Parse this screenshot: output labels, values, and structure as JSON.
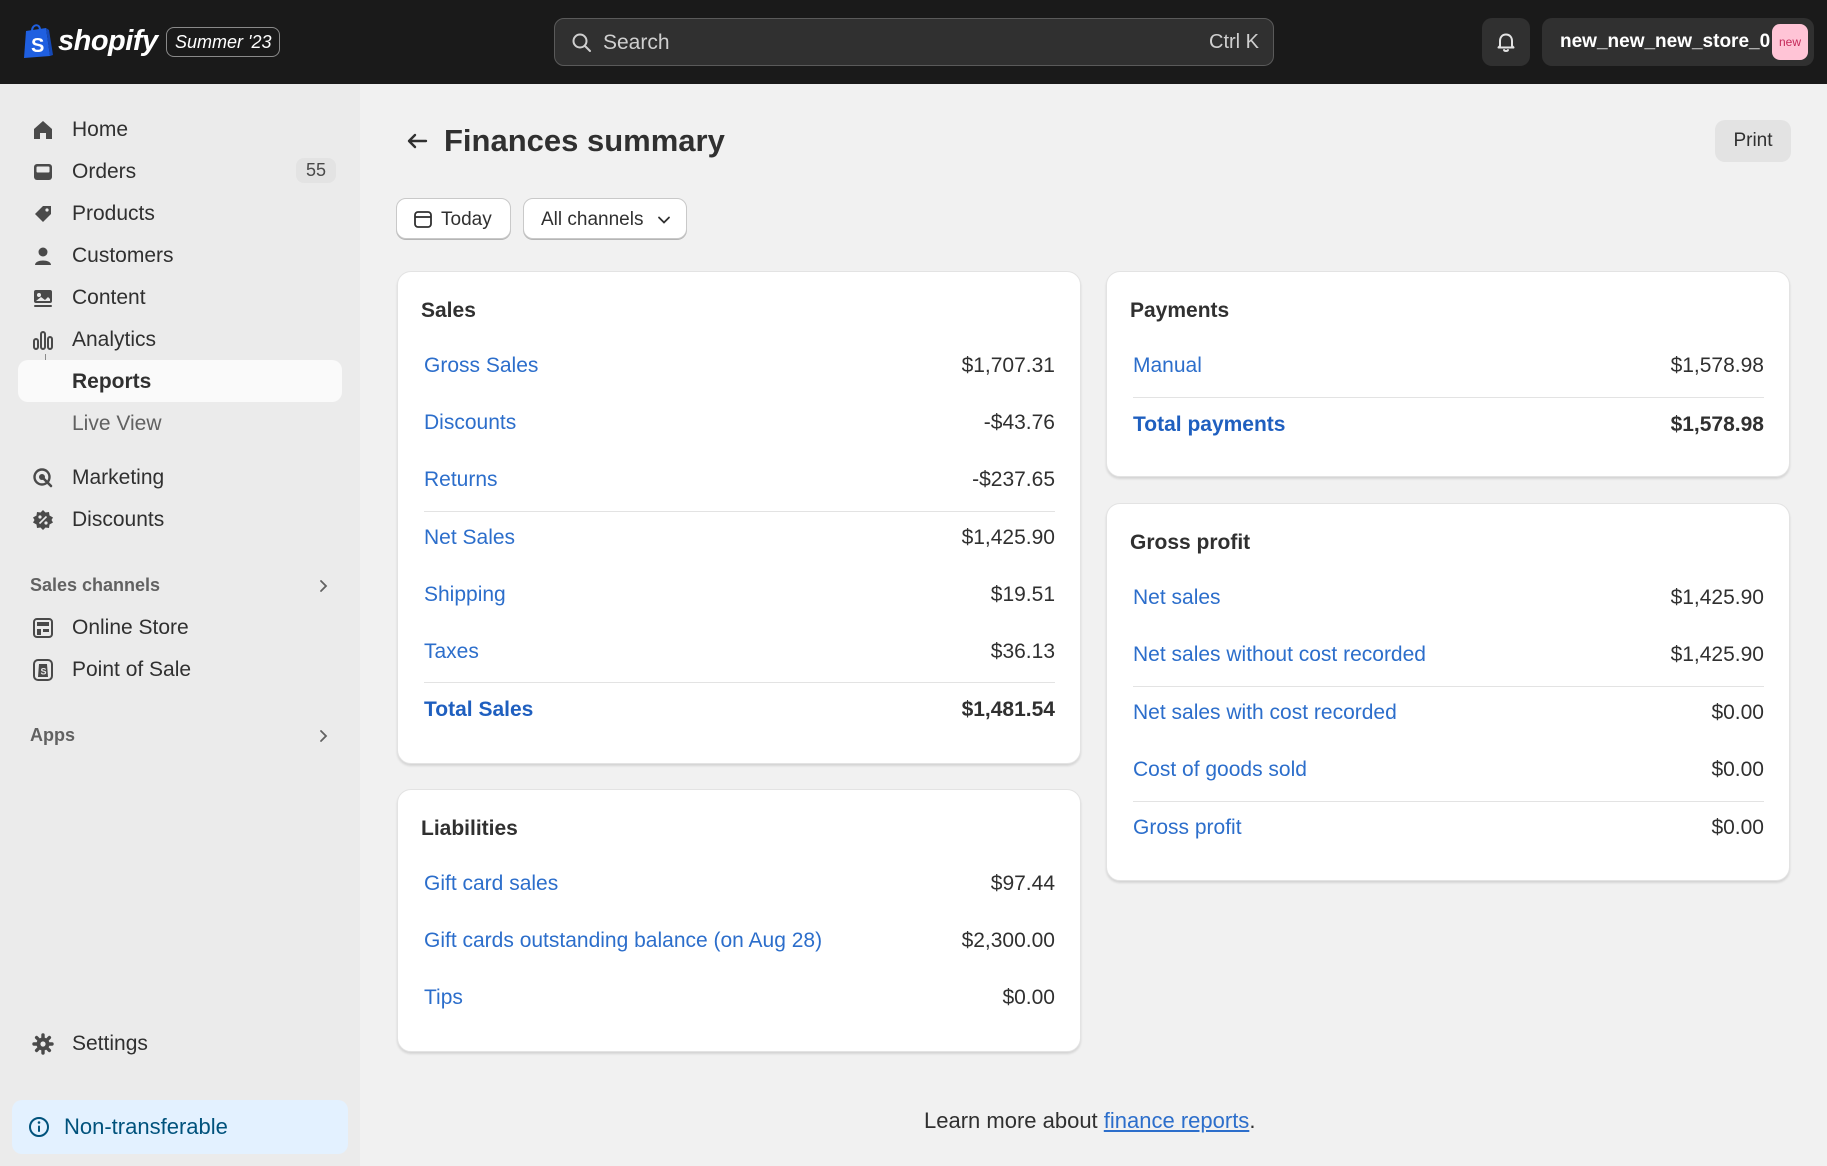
{
  "topbar": {
    "brand": "shopify",
    "edition": "Summer '23",
    "search_placeholder": "Search",
    "search_shortcut": "Ctrl K",
    "store_name": "new_new_new_store_0",
    "store_avatar": "new"
  },
  "sidebar": {
    "items": [
      {
        "label": "Home",
        "icon": "home-icon"
      },
      {
        "label": "Orders",
        "icon": "orders-icon",
        "badge": "55"
      },
      {
        "label": "Products",
        "icon": "tag-icon"
      },
      {
        "label": "Customers",
        "icon": "person-icon"
      },
      {
        "label": "Content",
        "icon": "content-icon"
      },
      {
        "label": "Analytics",
        "icon": "analytics-icon"
      },
      {
        "label": "Reports"
      },
      {
        "label": "Live View"
      },
      {
        "label": "Marketing",
        "icon": "marketing-icon"
      },
      {
        "label": "Discounts",
        "icon": "discount-icon"
      }
    ],
    "sales_channels_label": "Sales channels",
    "channels": [
      {
        "label": "Online Store",
        "icon": "store-icon"
      },
      {
        "label": "Point of Sale",
        "icon": "pos-icon"
      }
    ],
    "apps_label": "Apps",
    "settings_label": "Settings",
    "notice": "Non-transferable"
  },
  "page": {
    "title": "Finances summary",
    "print_label": "Print",
    "filters": {
      "date": "Today",
      "channels": "All channels"
    }
  },
  "sales": {
    "title": "Sales",
    "rows": [
      {
        "label": "Gross Sales",
        "value": "$1,707.31"
      },
      {
        "label": "Discounts",
        "value": "-$43.76"
      },
      {
        "label": "Returns",
        "value": "-$237.65"
      },
      {
        "label": "Net Sales",
        "value": "$1,425.90"
      },
      {
        "label": "Shipping",
        "value": "$19.51"
      },
      {
        "label": "Taxes",
        "value": "$36.13"
      },
      {
        "label": "Total Sales",
        "value": "$1,481.54"
      }
    ]
  },
  "liabilities": {
    "title": "Liabilities",
    "rows": [
      {
        "label": "Gift card sales",
        "value": "$97.44"
      },
      {
        "label": "Gift cards outstanding balance (on Aug 28)",
        "value": "$2,300.00"
      },
      {
        "label": "Tips",
        "value": "$0.00"
      }
    ]
  },
  "payments": {
    "title": "Payments",
    "rows": [
      {
        "label": "Manual",
        "value": "$1,578.98"
      },
      {
        "label": "Total payments",
        "value": "$1,578.98"
      }
    ]
  },
  "gross_profit": {
    "title": "Gross profit",
    "rows": [
      {
        "label": "Net sales",
        "value": "$1,425.90"
      },
      {
        "label": "Net sales without cost recorded",
        "value": "$1,425.90"
      },
      {
        "label": "Net sales with cost recorded",
        "value": "$0.00"
      },
      {
        "label": "Cost of goods sold",
        "value": "$0.00"
      },
      {
        "label": "Gross profit",
        "value": "$0.00"
      }
    ]
  },
  "footer": {
    "prefix": "Learn more about ",
    "link": "finance reports",
    "suffix": "."
  }
}
